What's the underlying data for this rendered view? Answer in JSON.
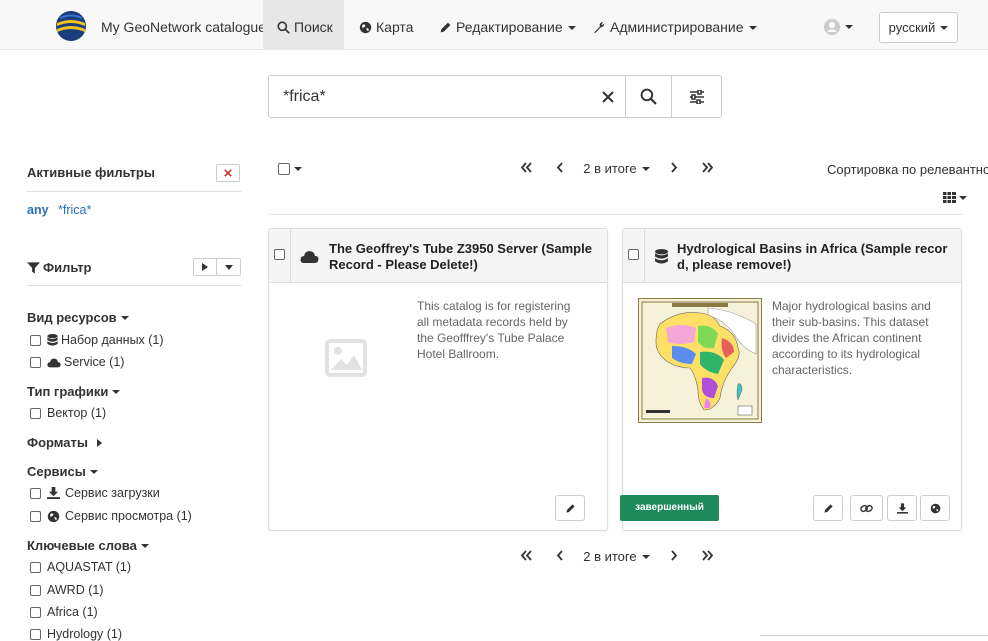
{
  "header": {
    "brand": "My GeoNetwork catalogue",
    "nav": {
      "search": "Поиск",
      "map": "Карта",
      "edit": "Редактирование",
      "admin": "Администрирование"
    },
    "language": "русский"
  },
  "search": {
    "query": "*frica*"
  },
  "sidebar": {
    "active_filters_title": "Активные фильтры",
    "active_filter_any": "any",
    "active_filter_value": "*frica*",
    "filter_title": "Фильтр",
    "groups": [
      {
        "title": "Вид ресурсов",
        "items": [
          "Набор данных (1)",
          "Service (1)"
        ]
      },
      {
        "title": "Тип графики",
        "items": [
          "Вектор (1)"
        ]
      },
      {
        "title": "Форматы",
        "items": []
      },
      {
        "title": "Сервисы",
        "items": [
          "Сервис загрузки",
          "Сервис просмотра (1)"
        ]
      },
      {
        "title": "Ключевые слова",
        "items": [
          "AQUASTAT (1)",
          "AWRD (1)",
          "Africa (1)",
          "Hydrology (1)"
        ]
      }
    ]
  },
  "results": {
    "total_label": "2 в итоге",
    "sort_label": "Сортировка по релевантности",
    "cards": [
      {
        "title_line1": "The Geoffrey's Tube Z3950 Server (Sample",
        "title_line2": "Record - Please Delete!)",
        "desc": [
          "This catalog is for registering",
          "all metadata records held by",
          "the Geofffrey's Tube Palace",
          "Hotel Ballroom."
        ]
      },
      {
        "title_line1": "Hydrological Basins in Africa (Sample recor",
        "title_line2": "d, please remove!)",
        "desc": [
          "Major hydrological basins and",
          "their sub-basins. This dataset",
          "divides the African continent",
          "according to its hydrological",
          "characteristics."
        ],
        "status": "завершенный"
      }
    ]
  },
  "colors": {
    "link": "#2a6ebb",
    "status": "#1e8a5a",
    "danger": "#c9302c"
  }
}
